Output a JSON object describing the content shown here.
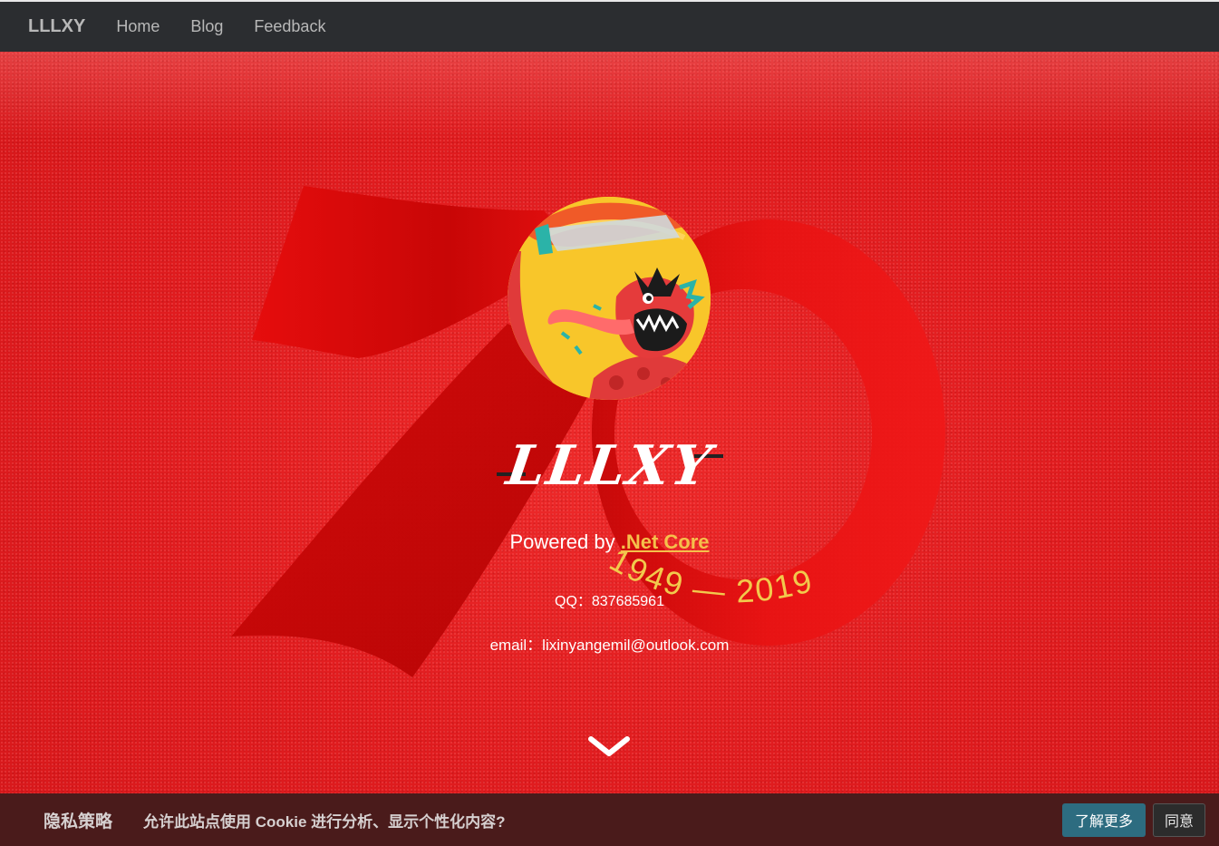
{
  "navbar": {
    "brand": "LLLXY",
    "links": [
      "Home",
      "Blog",
      "Feedback"
    ]
  },
  "hero": {
    "anniversary": "1949 — 2019",
    "title": "LLLXY",
    "powered_prefix": "Powered by ",
    "powered_link": ".Net Core",
    "qq": "QQ：837685961",
    "email": "email：lixinyangemil@outlook.com",
    "scroll_icon": "chevron-down-icon"
  },
  "cookie": {
    "title": "隐私策略",
    "message": "允许此站点使用 Cookie 进行分析、显示个性化内容?",
    "learn_more": "了解更多",
    "agree": "同意"
  },
  "colors": {
    "hero_red": "#e31a1c",
    "navbar": "#2b2d30",
    "link_gold": "#f5c04b",
    "cookie_bar": "#4a1b1b",
    "learn_button": "#2d6c80"
  }
}
